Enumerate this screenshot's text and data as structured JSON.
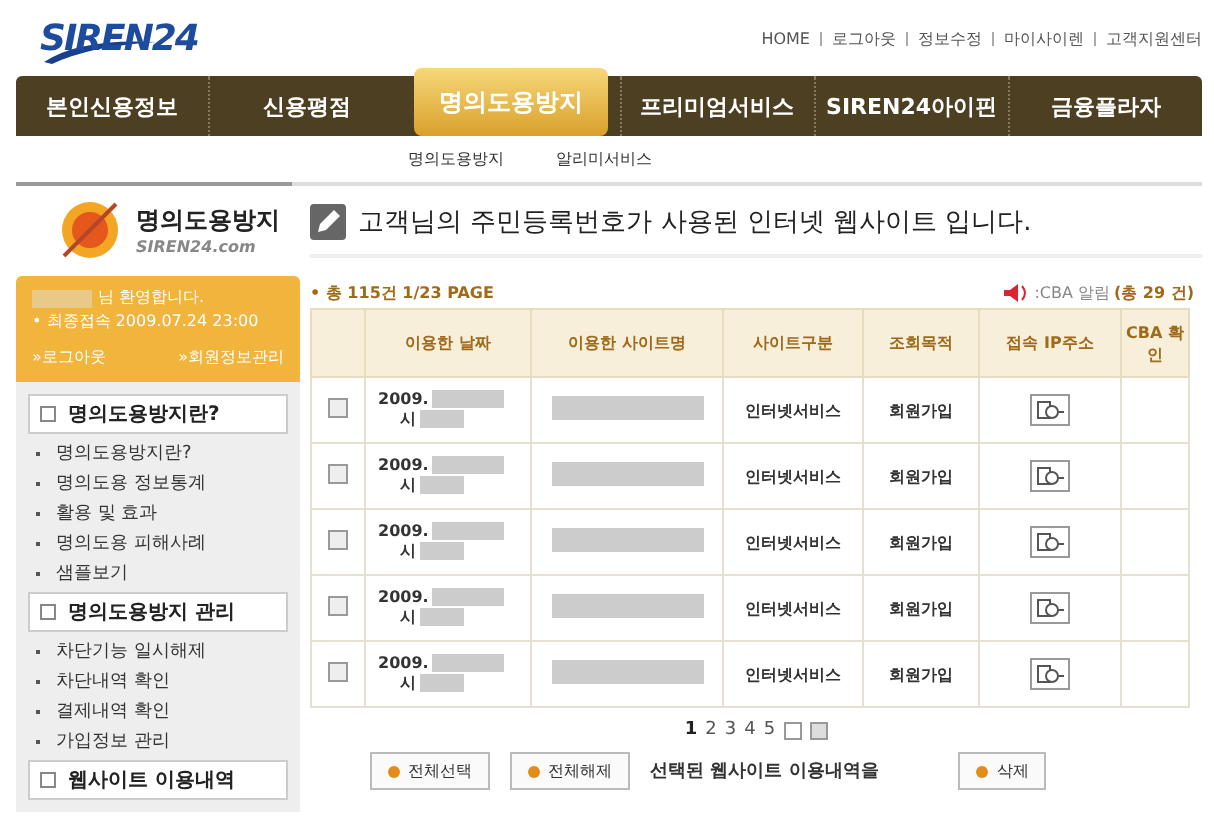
{
  "header": {
    "logo": "SIREN24",
    "top_links": [
      "HOME",
      "로그아웃",
      "정보수정",
      "마이사이렌",
      "고객지원센터"
    ]
  },
  "nav": {
    "tabs": [
      {
        "label": "본인신용정보",
        "selected": false
      },
      {
        "label": "신용평점",
        "selected": false
      },
      {
        "label": "명의도용방지",
        "selected": true
      },
      {
        "label": "프리미엄서비스",
        "selected": false
      },
      {
        "label": "SIREN24아이핀",
        "selected": false
      },
      {
        "label": "금융플라자",
        "selected": false
      }
    ],
    "subnav": [
      "명의도용방지",
      "알리미서비스"
    ]
  },
  "sidebar": {
    "brand": {
      "title": "명의도용방지",
      "subtitle": "SIREN24.com"
    },
    "welcome": {
      "greeting": "님 환영합니다.",
      "last_login": "• 최종접속 2009.07.24 23:00",
      "links": [
        "»로그아웃",
        "»회원정보관리"
      ]
    },
    "sections": [
      {
        "title": "명의도용방지란?",
        "items": [
          "명의도용방지란?",
          "명의도용 정보통계",
          "활용 및 효과",
          "명의도용 피해사례",
          "샘플보기"
        ]
      },
      {
        "title": "명의도용방지 관리",
        "items": [
          "차단기능 일시해제",
          "차단내역 확인",
          "결제내역 확인",
          "가입정보 관리"
        ]
      },
      {
        "title": "웹사이트 이용내역"
      }
    ]
  },
  "main": {
    "heading": "고객님의 주민등록번호가 사용된 인터넷 웹사이트 입니다.",
    "summary": "• 총 115건 1/23 PAGE",
    "cba_legend": ":CBA 알림",
    "cba_total": "(총 29 건)",
    "columns": [
      "이용한 날짜",
      "이용한 사이트명",
      "사이트구분",
      "조회목적",
      "접속 IP주소",
      "CBA 확인"
    ],
    "rows": [
      {
        "checked": false,
        "date": "2009.",
        "date_2": "시",
        "type": "인터넷서비스",
        "purpose": "회원가입"
      },
      {
        "checked": false,
        "date": "2009.",
        "date_2": "시",
        "type": "인터넷서비스",
        "purpose": "회원가입"
      },
      {
        "checked": false,
        "date": "2009.",
        "date_2": "시",
        "type": "인터넷서비스",
        "purpose": "회원가입"
      },
      {
        "checked": false,
        "date": "2009.",
        "date_2": "시",
        "type": "인터넷서비스",
        "purpose": "회원가입"
      },
      {
        "checked": false,
        "date": "2009.",
        "date_2": "시",
        "type": "인터넷서비스",
        "purpose": "회원가입"
      }
    ],
    "pages": [
      {
        "label": "1",
        "selected": true
      },
      {
        "label": "2",
        "selected": false
      },
      {
        "label": "3",
        "selected": false
      },
      {
        "label": "4",
        "selected": false
      },
      {
        "label": "5",
        "selected": false
      }
    ],
    "buttons": [
      "전체선택",
      "전체해제"
    ],
    "selected_label": "선택된 웹사이트 이용내역을",
    "delete_button": "삭제"
  }
}
